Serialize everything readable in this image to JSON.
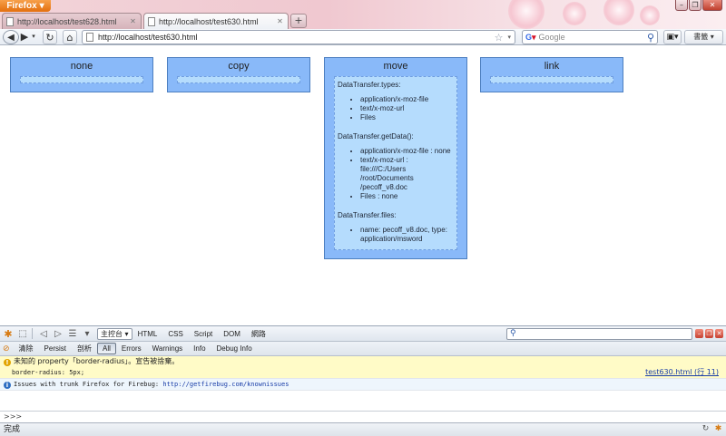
{
  "window": {
    "menu_label": "Firefox",
    "tabs": [
      {
        "label": "http://localhost/test628.html",
        "active": false
      },
      {
        "label": "http://localhost/test630.html",
        "active": true
      }
    ],
    "new_tab_label": "+",
    "controls": {
      "minimize": "–",
      "maximize": "❐",
      "close": "✕"
    }
  },
  "navbar": {
    "url": "http://localhost/test630.html",
    "search_placeholder": "Google",
    "bookmarks_label": "書籤"
  },
  "page": {
    "boxes": [
      {
        "title": "none"
      },
      {
        "title": "copy"
      },
      {
        "title": "move",
        "result": {
          "types_heading": "DataTransfer.types:",
          "types": [
            "application/x-moz-file",
            "text/x-moz-url",
            "Files"
          ],
          "getdata_heading": "DataTransfer.getData():",
          "getdata": [
            "application/x-moz-file : none",
            "text/x-moz-url : file:///C:/Users /root/Documents /pecoff_v8.doc",
            "Files : none"
          ],
          "files_heading": "DataTransfer.files:",
          "files": [
            "name: pecoff_v8.doc, type: application/msword"
          ]
        }
      },
      {
        "title": "link"
      }
    ]
  },
  "firebug": {
    "panel_select": "主控台",
    "tabs": [
      "HTML",
      "CSS",
      "Script",
      "DOM",
      "網路"
    ],
    "console_buttons": [
      "清除",
      "Persist",
      "剖析",
      "All",
      "Errors",
      "Warnings",
      "Info",
      "Debug Info"
    ],
    "active_button": "All",
    "messages": [
      {
        "kind": "warning",
        "text": "未知的 property「border-radius」。宣告被捨棄。",
        "detail": "border-radius: 5px;",
        "source": "test630.html (行 11)"
      },
      {
        "kind": "info",
        "text": "Issues with trunk Firefox for Firebug: ",
        "link": "http://getfirebug.com/knownissues"
      }
    ],
    "command_prompt": ">>>"
  },
  "status": {
    "text": "完成"
  }
}
